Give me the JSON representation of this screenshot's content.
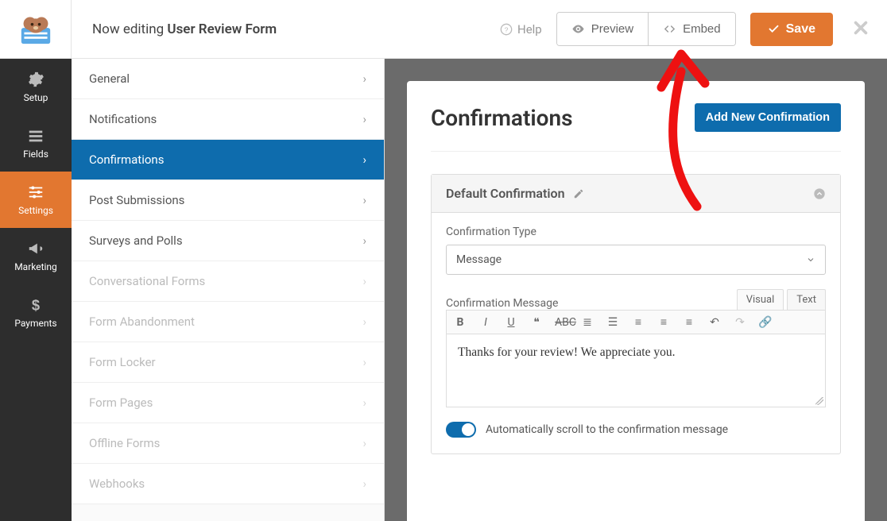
{
  "header": {
    "editing_prefix": "Now editing ",
    "form_name": "User Review Form",
    "help_label": "Help",
    "preview_label": "Preview",
    "embed_label": "Embed",
    "save_label": "Save"
  },
  "rail": {
    "setup": "Setup",
    "fields": "Fields",
    "settings": "Settings",
    "marketing": "Marketing",
    "payments": "Payments"
  },
  "submenu": {
    "items": [
      {
        "label": "General",
        "state": "normal"
      },
      {
        "label": "Notifications",
        "state": "normal"
      },
      {
        "label": "Confirmations",
        "state": "active"
      },
      {
        "label": "Post Submissions",
        "state": "normal"
      },
      {
        "label": "Surveys and Polls",
        "state": "normal"
      },
      {
        "label": "Conversational Forms",
        "state": "disabled"
      },
      {
        "label": "Form Abandonment",
        "state": "disabled"
      },
      {
        "label": "Form Locker",
        "state": "disabled"
      },
      {
        "label": "Form Pages",
        "state": "disabled"
      },
      {
        "label": "Offline Forms",
        "state": "disabled"
      },
      {
        "label": "Webhooks",
        "state": "disabled"
      }
    ]
  },
  "panel": {
    "title": "Confirmations",
    "add_new_label": "Add New Confirmation",
    "card_title": "Default Confirmation",
    "conf_type_label": "Confirmation Type",
    "conf_type_value": "Message",
    "conf_msg_label": "Confirmation Message",
    "tab_visual": "Visual",
    "tab_text": "Text",
    "editor_content": "Thanks for your review! We appreciate you.",
    "toggle_label": "Automatically scroll to the confirmation message"
  }
}
